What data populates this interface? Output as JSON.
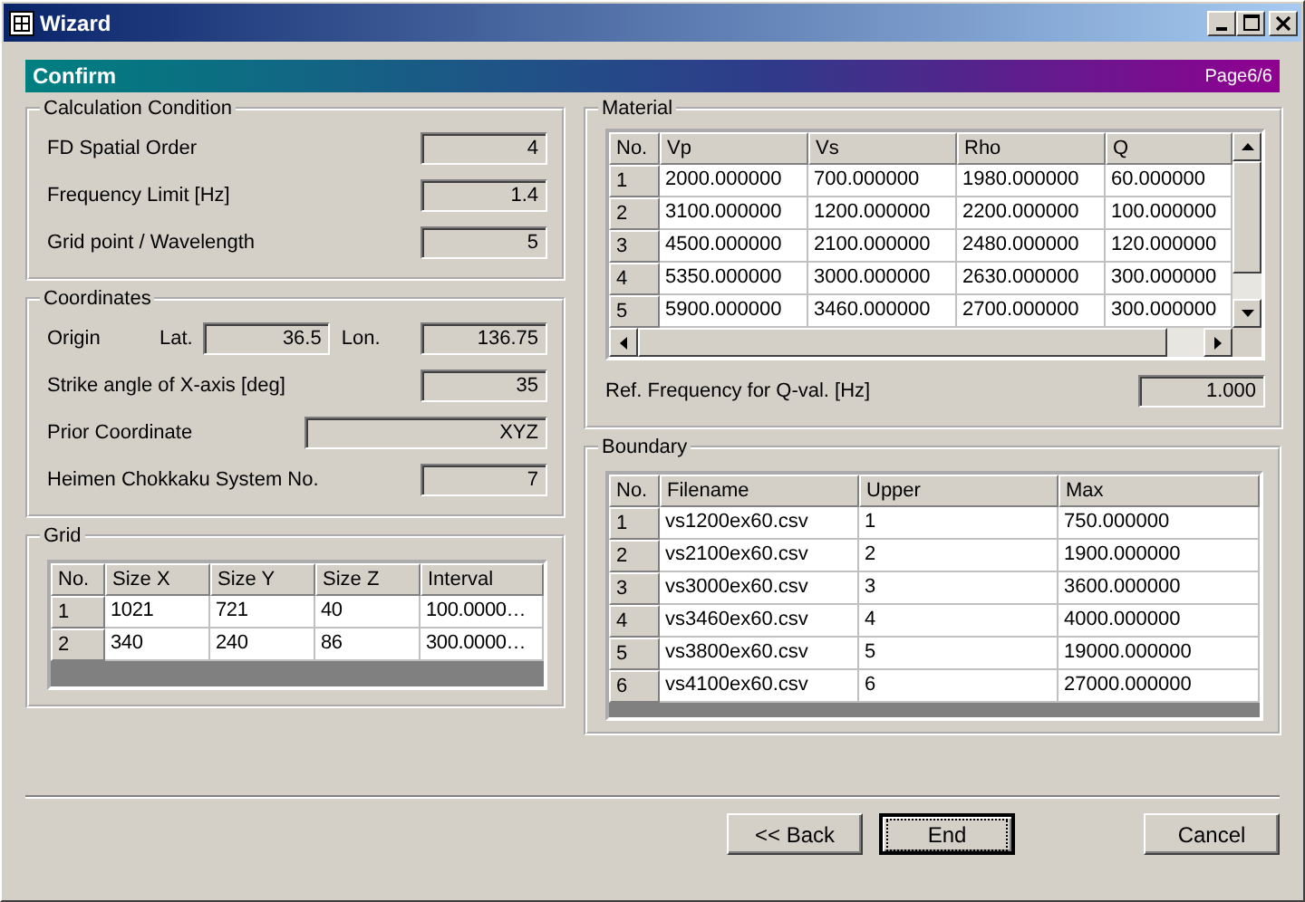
{
  "window": {
    "title": "Wizard"
  },
  "header": {
    "title": "Confirm",
    "page": "Page6/6"
  },
  "calculation_condition": {
    "title": "Calculation Condition",
    "fields": [
      {
        "label": "FD Spatial Order",
        "value": "4"
      },
      {
        "label": "Frequency Limit [Hz]",
        "value": "1.4"
      },
      {
        "label": "Grid point / Wavelength",
        "value": "5"
      }
    ]
  },
  "coordinates": {
    "title": "Coordinates",
    "origin_label": "Origin",
    "lat_label": "Lat.",
    "lat_value": "36.5",
    "lon_label": "Lon.",
    "lon_value": "136.75",
    "fields": [
      {
        "label": "Strike angle of X-axis [deg]",
        "value": "35",
        "kind": "short"
      },
      {
        "label": "Prior Coordinate",
        "value": "XYZ",
        "kind": "wide"
      },
      {
        "label": "Heimen Chokkaku System No.",
        "value": "7",
        "kind": "short"
      }
    ]
  },
  "grid": {
    "title": "Grid",
    "columns": [
      "No.",
      "Size X",
      "Size Y",
      "Size Z",
      "Interval"
    ],
    "rows": [
      [
        "1",
        "1021",
        "721",
        "40",
        "100.0000…"
      ],
      [
        "2",
        "340",
        "240",
        "86",
        "300.0000…"
      ]
    ]
  },
  "material": {
    "title": "Material",
    "columns": [
      "No.",
      "Vp",
      "Vs",
      "Rho",
      "Q"
    ],
    "rows": [
      [
        "1",
        "2000.000000",
        "700.000000",
        "1980.000000",
        "60.000000"
      ],
      [
        "2",
        "3100.000000",
        "1200.000000",
        "2200.000000",
        "100.000000"
      ],
      [
        "3",
        "4500.000000",
        "2100.000000",
        "2480.000000",
        "120.000000"
      ],
      [
        "4",
        "5350.000000",
        "3000.000000",
        "2630.000000",
        "300.000000"
      ],
      [
        "5",
        "5900.000000",
        "3460.000000",
        "2700.000000",
        "300.000000"
      ]
    ],
    "ref_label": "Ref. Frequency for Q-val. [Hz]",
    "ref_value": "1.000"
  },
  "boundary": {
    "title": "Boundary",
    "columns": [
      "No.",
      "Filename",
      "Upper",
      "Max"
    ],
    "rows": [
      [
        "1",
        "vs1200ex60.csv",
        "1",
        "750.000000"
      ],
      [
        "2",
        "vs2100ex60.csv",
        "2",
        "1900.000000"
      ],
      [
        "3",
        "vs3000ex60.csv",
        "3",
        "3600.000000"
      ],
      [
        "4",
        "vs3460ex60.csv",
        "4",
        "4000.000000"
      ],
      [
        "5",
        "vs3800ex60.csv",
        "5",
        "19000.000000"
      ],
      [
        "6",
        "vs4100ex60.csv",
        "6",
        "27000.000000"
      ]
    ]
  },
  "buttons": [
    {
      "label": "<< Back",
      "focused": false
    },
    {
      "label": "End",
      "focused": true
    },
    {
      "label": "Cancel",
      "focused": false
    }
  ]
}
